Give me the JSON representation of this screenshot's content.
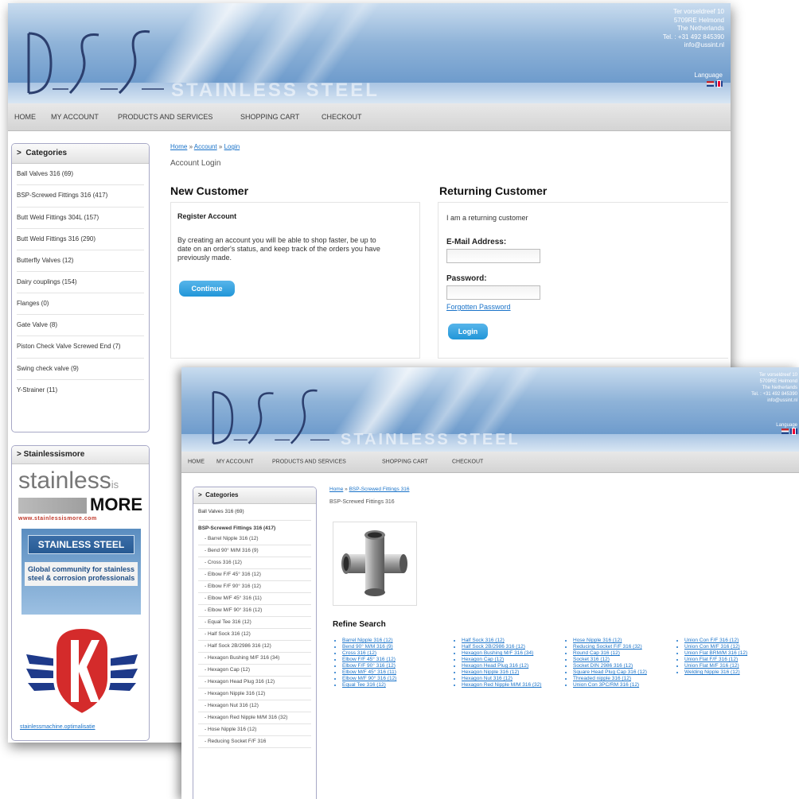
{
  "colors": {
    "accent_button": "#2196d8",
    "link": "#1a73c9",
    "box_border": "#a7a8c6"
  },
  "icons": [
    "shield-k-logo",
    "netherlands-flag",
    "uk-flag"
  ],
  "header": {
    "address_lines": [
      "Ter vorseldreef 10",
      "5709RE Helmond",
      "The Netherlands",
      "Tel. : +31 492 845390",
      "info@ussint.nl"
    ],
    "language_label": "Language",
    "watermark": "STAINLESS STEEL"
  },
  "nav": [
    "HOME",
    "MY ACCOUNT",
    "PRODUCTS AND SERVICES",
    "SHOPPING CART",
    "CHECKOUT"
  ],
  "login_page": {
    "breadcrumb": [
      "Home",
      "Account",
      "Login"
    ],
    "subtitle": "Account Login",
    "categories_title": "Categories",
    "categories": [
      "Ball Valves 316 (69)",
      "BSP-Screwed Fittings 316 (417)",
      "Butt Weld Fittings 304L (157)",
      "Butt Weld Fittings 316 (290)",
      "Butterfly Valves (12)",
      "Dairy couplings (154)",
      "Flanges (0)",
      "Gate Valve (8)",
      "Piston Check Valve Screwed End (7)",
      "Swing check valve (9)",
      "Y-Strainer (11)"
    ],
    "new_customer": {
      "title": "New Customer",
      "subtitle": "Register Account",
      "text": "By creating an account you will be able to shop faster, be up to date on an order's status, and keep track of the orders you have previously made.",
      "button": "Continue"
    },
    "returning_customer": {
      "title": "Returning Customer",
      "intro": "I am a returning customer",
      "email_label": "E-Mail Address:",
      "password_label": "Password:",
      "forgot_link": "Forgotten Password",
      "button": "Login"
    },
    "ad_box": {
      "title": "> Stainlessismore",
      "logo_main": "stainless",
      "logo_is": "is",
      "logo_more": "MORE",
      "logo_url": "www.stainlessismore.com",
      "banner_title": "STAINLESS STEEL",
      "banner_text": "Global community for stainless steel & corrosion professionals",
      "footer_link": "stainlessmachine.optimalisatie"
    }
  },
  "products_page": {
    "breadcrumb": [
      "Home",
      "BSP-Screwed Fittings 316"
    ],
    "subtitle": "BSP-Screwed Fittings 316",
    "categories_title": "Categories",
    "categories": [
      "Ball Valves 316 (69)",
      "BSP-Screwed Fittings 316 (417)"
    ],
    "subcategories": [
      "- Barrel Nipple 316 (12)",
      "- Bend 90° M/M 316 (9)",
      "- Cross 316 (12)",
      "- Elbow F/F 45° 316 (12)",
      "- Elbow F/F 90° 316 (12)",
      "- Elbow M/F 45° 316 (11)",
      "- Elbow M/F 90° 316 (12)",
      "- Equal Tee 316 (12)",
      "- Half Sock 316 (12)",
      "- Half Sock 2B/2986 316 (12)",
      "- Hexagon Bushing M/F 316 (34)",
      "- Hexagon Cap (12)",
      "- Hexagon Head Plug 316 (12)",
      "- Hexagon Nipple 316 (12)",
      "- Hexagon Nut 316 (12)",
      "- Hexagon Red Nipple M/M 316 (32)",
      "- Hose Nipple 316 (12)",
      "- Reducing Socket F/F 316"
    ],
    "refine_title": "Refine Search",
    "refine_columns": [
      [
        "Barrel Nipple 316 (12)",
        "Bend 90° M/M 316 (9)",
        "Cross 316 (12)",
        "Elbow F/F 45° 316 (12)",
        "Elbow F/F 90° 316 (12)",
        "Elbow M/F 45° 316 (11)",
        "Elbow M/F 90° 316 (12)",
        "Equal Tee 316 (12)"
      ],
      [
        "Half Sock 316 (12)",
        "Half Sock 2B/2986 316 (12)",
        "Hexagon Bushing M/F 316 (34)",
        "Hexagon Cap (12)",
        "Hexagon Head Plug 316 (12)",
        "Hexagon Nipple 316 (12)",
        "Hexagon Nut 316 (12)",
        "Hexagon Red Nipple M/M 316 (32)"
      ],
      [
        "Hose Nipple 316 (12)",
        "Reducing Socket F/F 316 (32)",
        "Round Cap 316 (12)",
        "Socket 316 (12)",
        "Socket DIN 2986 316 (12)",
        "Square Head Plug Cap 316 (12)",
        "Threaded nipple 316 (12)",
        "Union Con 3PC/RM 316 (12)"
      ],
      [
        "Union Con F/F 316 (12)",
        "Union Con M/F 316 (12)",
        "Union Flat BRM/M 316 (12)",
        "Union Flat F/F 316 (12)",
        "Union Flat M/F 316 (12)",
        "Welding Nipple 316 (12)"
      ]
    ]
  }
}
